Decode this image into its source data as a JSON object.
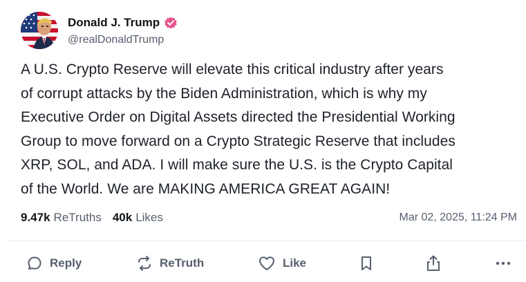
{
  "author": {
    "display_name": "Donald J. Trump",
    "handle": "@realDonaldTrump",
    "verified_color": "#e8538f"
  },
  "post": {
    "lines": [
      "A U.S. Crypto Reserve will elevate this critical industry after years",
      "of corrupt attacks by the Biden Administration, which is why my",
      "Executive Order on Digital Assets directed the Presidential Working",
      "Group to move forward on a Crypto Strategic Reserve that includes",
      "XRP, SOL, and ADA. I will make sure the U.S. is the Crypto Capital",
      "of the World. We are MAKING AMERICA GREAT AGAIN!"
    ]
  },
  "stats": {
    "retruths_count": "9.47k",
    "retruths_label": "ReTruths",
    "likes_count": "40k",
    "likes_label": "Likes",
    "timestamp": "Mar 02, 2025, 11:24 PM"
  },
  "actions": {
    "reply_label": "Reply",
    "retruth_label": "ReTruth",
    "like_label": "Like"
  },
  "icons": {
    "avatar": "flag-portrait-avatar",
    "verified": "verified-badge-icon",
    "reply": "speech-bubble-icon",
    "retruth": "retruth-arrows-icon",
    "like": "heart-icon",
    "bookmark": "bookmark-icon",
    "share": "share-icon",
    "more": "more-dots-icon"
  },
  "colors": {
    "text": "#0f1419",
    "muted": "#555e6b",
    "divider": "#e6e8eb"
  }
}
